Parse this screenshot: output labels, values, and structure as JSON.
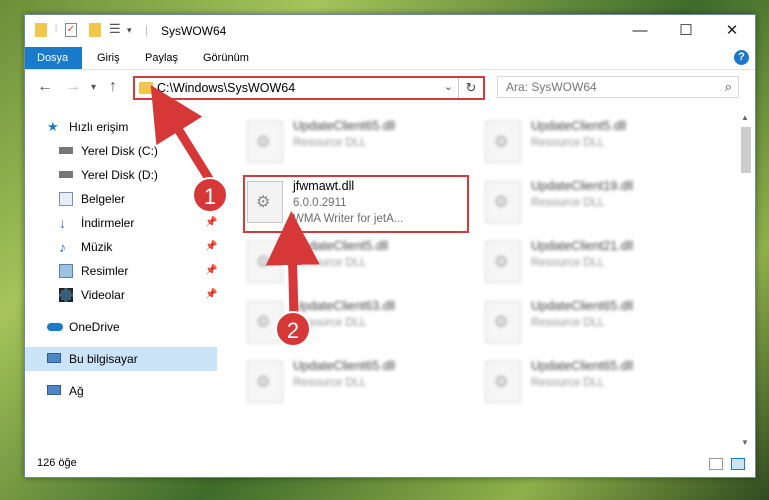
{
  "window": {
    "title": "SysWOW64",
    "controls": {
      "minimize": "—",
      "maximize": "☐",
      "close": "✕"
    }
  },
  "ribbon": {
    "tabs": [
      "Dosya",
      "Giriş",
      "Paylaş",
      "Görünüm"
    ],
    "help": "?"
  },
  "nav": {
    "address": "C:\\Windows\\SysWOW64",
    "search_placeholder": "Ara: SysWOW64"
  },
  "sidebar": {
    "items": [
      {
        "label": "Hızlı erişim",
        "icon": "star-icon"
      },
      {
        "label": "Yerel Disk (C:)",
        "icon": "drive-icon"
      },
      {
        "label": "Yerel Disk (D:)",
        "icon": "drive-icon"
      },
      {
        "label": "Belgeler",
        "icon": "documents-icon"
      },
      {
        "label": "İndirmeler",
        "icon": "download-icon"
      },
      {
        "label": "Müzik",
        "icon": "music-icon"
      },
      {
        "label": "Resimler",
        "icon": "pictures-icon"
      },
      {
        "label": "Videolar",
        "icon": "video-icon"
      },
      {
        "label": "OneDrive",
        "icon": "cloud-icon"
      },
      {
        "label": "Bu bilgisayar",
        "icon": "computer-icon"
      },
      {
        "label": "Ağ",
        "icon": "network-icon"
      }
    ]
  },
  "files": {
    "left": [
      {
        "name": "UpdateClient65.dll",
        "desc": "Resource DLL"
      },
      {
        "name": "jfwmawt.dll",
        "desc": "6.0.0.2911",
        "desc2": "WMA Writer for jetA..."
      },
      {
        "name": "UpdateClient5.dll",
        "desc": "Resource DLL"
      },
      {
        "name": "UpdateClient63.dll",
        "desc": "Resource DLL"
      },
      {
        "name": "UpdateClient65.dll",
        "desc": "Resource DLL"
      }
    ],
    "right": [
      {
        "name": "UpdateClient5.dll",
        "desc": "Resource DLL"
      },
      {
        "name": "UpdateClient19.dll",
        "desc": "Resource DLL"
      },
      {
        "name": "UpdateClient21.dll",
        "desc": "Resource DLL"
      },
      {
        "name": "UpdateClient65.dll",
        "desc": "Resource DLL"
      },
      {
        "name": "UpdateClient65.dll",
        "desc": "Resource DLL"
      }
    ]
  },
  "status": {
    "count": "126 öğe"
  },
  "annotations": {
    "step1": "1",
    "step2": "2",
    "color": "#d63838"
  }
}
